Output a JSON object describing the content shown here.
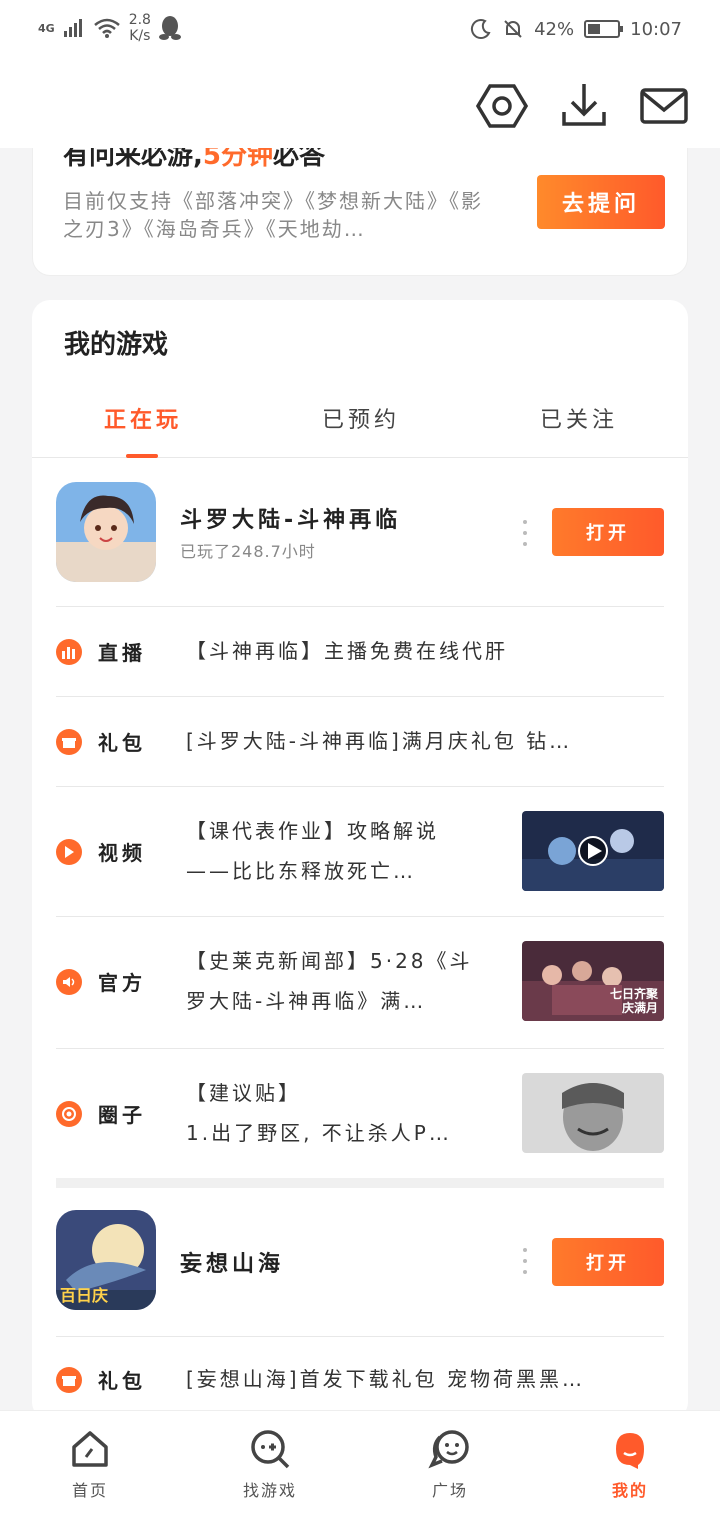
{
  "status_bar": {
    "network": "4G",
    "speed_value": "2.8",
    "speed_unit": "K/s",
    "battery": "42%",
    "time": "10:07"
  },
  "header": {
    "icons": [
      "settings-icon",
      "download-icon",
      "mail-icon"
    ]
  },
  "qa_card": {
    "title_prefix": "有问来必游,",
    "title_highlight": "5分钟",
    "title_suffix": "必答",
    "description": "目前仅支持《部落冲突》《梦想新大陆》《影之刃3》《海岛奇兵》《天地劫…",
    "ask_button": "去提问"
  },
  "my_games": {
    "title": "我的游戏",
    "tabs": [
      "正在玩",
      "已预约",
      "已关注"
    ],
    "active_tab": "正在玩",
    "games": [
      {
        "name": "斗罗大陆-斗神再临",
        "subtitle": "已玩了248.7小时",
        "open_button": "打开",
        "feeds": [
          {
            "label": "直播",
            "text": "【斗神再临】主播免费在线代肝",
            "icon": "live-icon"
          },
          {
            "label": "礼包",
            "text": "[斗罗大陆-斗神再临]满月庆礼包 钻…",
            "icon": "gift-icon"
          },
          {
            "label": "视频",
            "text_line1": "【课代表作业】攻略解说",
            "text_line2": "——比比东释放死亡…",
            "icon": "video-icon"
          },
          {
            "label": "官方",
            "text_line1": "【史莱克新闻部】5·28《斗",
            "text_line2": "罗大陆-斗神再临》满…",
            "icon": "speaker-icon",
            "thumb_text": "七日齐聚 庆满月"
          },
          {
            "label": "圈子",
            "text_line1": "【建议贴】",
            "text_line2": "1.出了野区, 不让杀人P…",
            "icon": "circle-icon"
          }
        ]
      },
      {
        "name": "妄想山海",
        "icon_badge": "百日庆",
        "open_button": "打开",
        "feeds": [
          {
            "label": "礼包",
            "text": "[妄想山海]首发下载礼包 宠物荷黑黑…",
            "icon": "gift-icon"
          }
        ]
      }
    ]
  },
  "bottom_nav": [
    {
      "label": "首页",
      "icon": "home-icon"
    },
    {
      "label": "找游戏",
      "icon": "find-game-icon"
    },
    {
      "label": "广场",
      "icon": "square-chat-icon"
    },
    {
      "label": "我的",
      "icon": "profile-icon",
      "active": true
    }
  ],
  "colors": {
    "accent": "#ff5a2b",
    "background": "#f4f4f5"
  }
}
